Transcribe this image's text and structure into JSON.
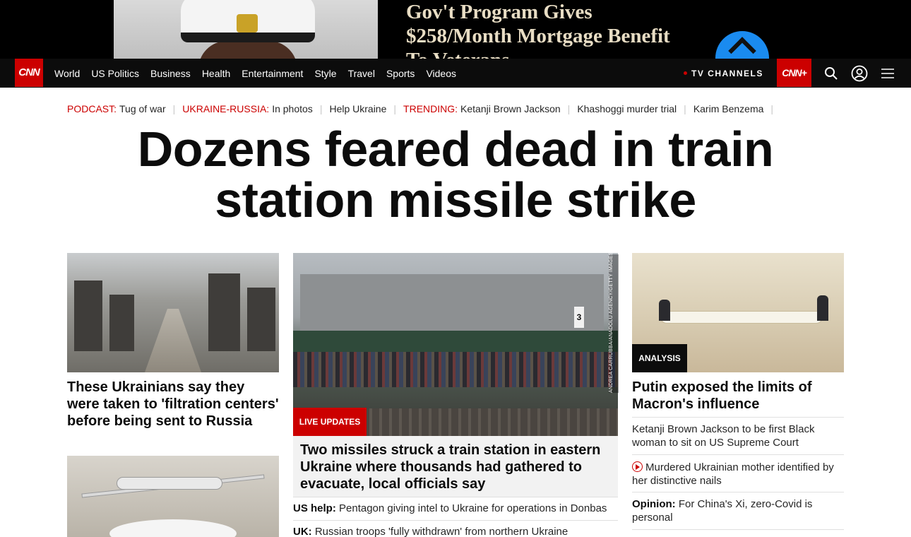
{
  "ad": {
    "line1": "Gov't Program Gives",
    "line2": "$258/Month Mortgage Benefit",
    "line3": "To Veterans"
  },
  "nav": {
    "logo": "CNN",
    "links": [
      "World",
      "US Politics",
      "Business",
      "Health",
      "Entertainment",
      "Style",
      "Travel",
      "Sports",
      "Videos"
    ],
    "tv_channels": "TV CHANNELS",
    "cnn_plus": "CNN+",
    "icons": [
      "search-icon",
      "account-icon",
      "menu-icon"
    ]
  },
  "trending": [
    {
      "key": "PODCAST:",
      "value": "Tug of war"
    },
    {
      "key": "UKRAINE-RUSSIA:",
      "value": "In photos"
    },
    {
      "key": "",
      "value": "Help Ukraine"
    },
    {
      "key": "TRENDING:",
      "value": "Ketanji Brown Jackson"
    },
    {
      "key": "",
      "value": "Khashoggi murder trial"
    },
    {
      "key": "",
      "value": "Karim Benzema"
    }
  ],
  "headline": "Dozens feared dead in train station missile strike",
  "left": {
    "story1": "These Ukrainians say they were taken to 'filtration centers' before being sent to Russia"
  },
  "middle": {
    "photo_credit": "ANDREA CARRUBBA/ANADOLU AGENCY/GETTY IMAGES",
    "sign": "3",
    "badge": "LIVE UPDATES",
    "lead": "Two missiles struck a train station in eastern Ukraine where thousands had gathered to evacuate, local officials say",
    "items": [
      {
        "kicker": "US help:",
        "text": "Pentagon giving intel to Ukraine for operations in Donbas"
      },
      {
        "kicker": "UK:",
        "text": "Russian troops 'fully withdrawn' from northern Ukraine"
      }
    ]
  },
  "right": {
    "badge": "ANALYSIS",
    "headline": "Putin exposed the limits of Macron's influence",
    "items": [
      {
        "kicker": "",
        "text": "Ketanji Brown Jackson to be first Black woman to sit on US Supreme Court"
      },
      {
        "kicker": "",
        "text": "Murdered Ukrainian mother identified by her distinctive nails",
        "video": true
      },
      {
        "kicker": "Opinion:",
        "text": "For China's Xi, zero-Covid is personal"
      }
    ]
  },
  "colors": {
    "brand_red": "#cc0000",
    "nav_bg": "#0c0c0c"
  }
}
